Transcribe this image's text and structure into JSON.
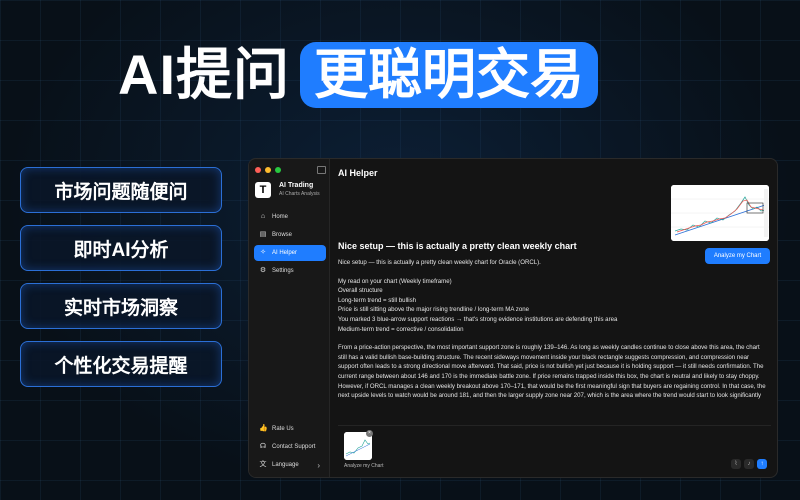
{
  "headline": {
    "plain": "AI提问",
    "highlight": "更聪明交易"
  },
  "features": [
    "市场问题随便问",
    "即时AI分析",
    "实时市场洞察",
    "个性化交易提醒"
  ],
  "app": {
    "brand_name": "AI Trading",
    "brand_sub": "AI Charts Analysis",
    "nav": [
      {
        "label": "Home",
        "icon": "home-icon"
      },
      {
        "label": "Browse",
        "icon": "browse-icon"
      },
      {
        "label": "AI Helper",
        "icon": "ai-helper-icon",
        "active": true
      },
      {
        "label": "Settings",
        "icon": "gear-icon"
      }
    ],
    "bottom_nav": [
      {
        "label": "Rate Us",
        "icon": "thumbs-up-icon"
      },
      {
        "label": "Contact Support",
        "icon": "headset-icon"
      },
      {
        "label": "Language",
        "icon": "translate-icon"
      }
    ]
  },
  "main": {
    "title": "AI Helper",
    "analyze_button": "Analyze my Chart",
    "composer_label": "Analyze my Chart",
    "message": {
      "heading": "Nice setup — this is actually a pretty clean weekly chart",
      "intro": "Nice setup — this is actually a pretty clean weekly chart for Oracle (ORCL).",
      "lines": [
        "My read on your chart (Weekly timeframe)",
        "Overall structure",
        "Long-term trend = still bullish",
        "Price is still sitting above the major rising trendline / long-term MA zone",
        "You marked 3 blue-arrow support reactions → that's strong evidence institutions are defending this area",
        "Medium-term trend = corrective / consolidation"
      ],
      "paragraph": "From a price-action perspective, the most important support zone is roughly 139–146. As long as weekly candles continue to close above this area, the chart still has a valid bullish base-building structure. The recent sideways movement inside your black rectangle suggests compression, and compression near support often leads to a strong directional move afterward. That said, price is not bullish yet just because it is holding support — it still needs confirmation. The current range between about 146 and 170 is the immediate battle zone. If price remains trapped inside this box, the chart is neutral and likely to stay choppy. However, if ORCL manages a clean weekly breakout above 170–171, that would be the first meaningful sign that buyers are regaining control. In that case, the next upside levels to watch would be around 181, and then the larger supply zone near 207, which is the area where the trend would start to look significantly"
    }
  },
  "colors": {
    "accent": "#1f7dff",
    "window_bg": "#141414",
    "page_bg": "#081018"
  }
}
